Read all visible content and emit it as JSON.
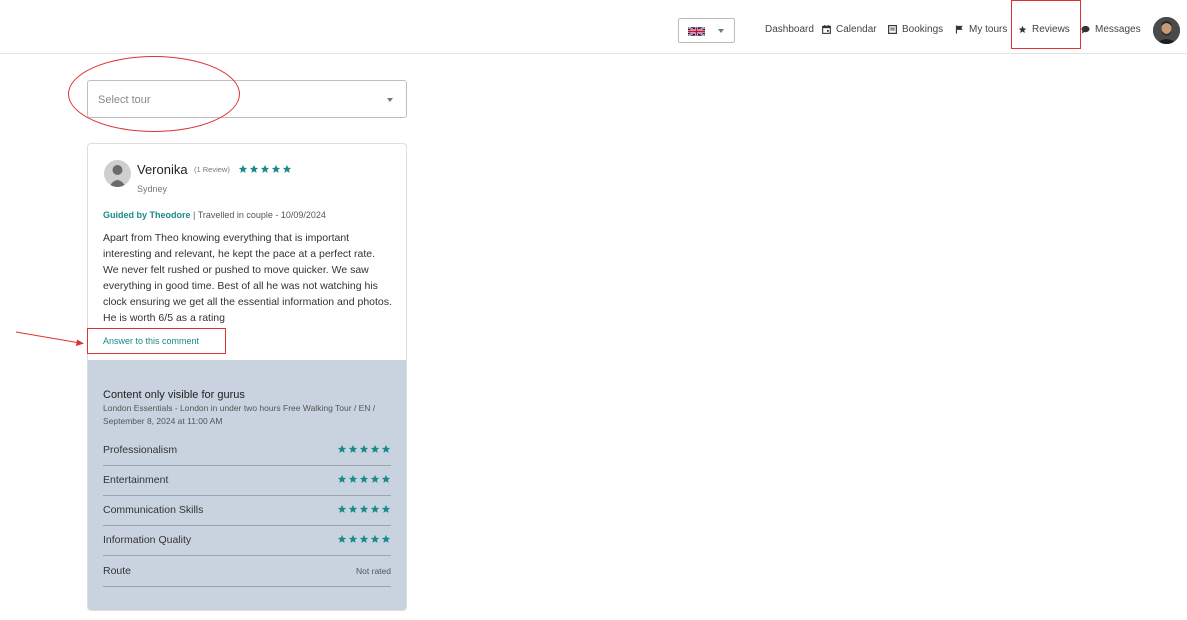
{
  "language": {
    "selected": "EN"
  },
  "nav": {
    "dashboard": "Dashboard",
    "calendar": "Calendar",
    "bookings": "Bookings",
    "my_tours": "My tours",
    "reviews": "Reviews",
    "messages": "Messages"
  },
  "tour_select": {
    "placeholder": "Select tour"
  },
  "review": {
    "name": "Veronika",
    "review_count": "(1 Review)",
    "rating": 5,
    "city": "Sydney",
    "guide": "Guided by Theodore",
    "details": " | Travelled in couple - 10/09/2024",
    "text": "Apart from Theo knowing everything that is important interesting and relevant, he kept the pace at a perfect rate. We never felt rushed or pushed to move quicker. We saw everything in good time. Best of all he was not watching his clock ensuring we get all the essential information and photos. He is worth 6/5 as a rating",
    "answer_link": "Answer to this comment"
  },
  "guru_section": {
    "title": "Content only visible for gurus",
    "subtitle": "London Essentials - London in under two hours Free Walking Tour / EN / September 8, 2024 at 11:00 AM",
    "ratings": [
      {
        "label": "Professionalism",
        "stars": 5
      },
      {
        "label": "Entertainment",
        "stars": 5
      },
      {
        "label": "Communication Skills",
        "stars": 5
      },
      {
        "label": "Information Quality",
        "stars": 5
      },
      {
        "label": "Route",
        "value": "Not rated"
      }
    ]
  },
  "colors": {
    "accent": "#1a8a8a",
    "annotation": "#dd3333",
    "guru_bg": "#c9d3df"
  }
}
